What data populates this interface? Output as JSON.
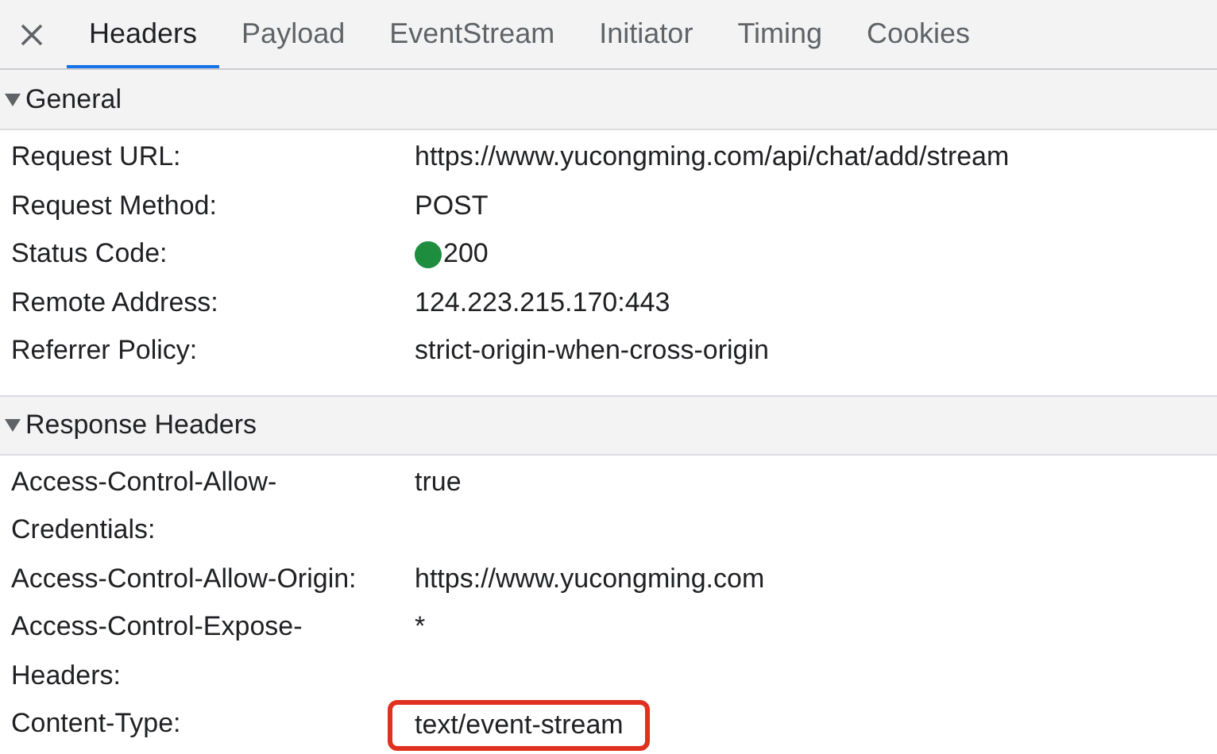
{
  "tabs": [
    {
      "label": "Headers",
      "selected": true
    },
    {
      "label": "Payload",
      "selected": false
    },
    {
      "label": "EventStream",
      "selected": false
    },
    {
      "label": "Initiator",
      "selected": false
    },
    {
      "label": "Timing",
      "selected": false
    },
    {
      "label": "Cookies",
      "selected": false
    }
  ],
  "sections": [
    {
      "title": "General",
      "expanded": true,
      "rows": [
        {
          "name": "Request URL:",
          "value": "https://www.yucongming.com/api/chat/add/stream"
        },
        {
          "name": "Request Method:",
          "value": "POST"
        },
        {
          "name": "Status Code:",
          "value": "200",
          "color": "#1e8e3e"
        },
        {
          "name": "Remote Address:",
          "value": "124.223.215.170:443"
        },
        {
          "name": "Referrer Policy:",
          "value": "strict-origin-when-cross-origin"
        }
      ]
    },
    {
      "title": "Response Headers",
      "expanded": true,
      "rows": [
        {
          "name": "Access-Control-Allow-Credentials:",
          "value": "true"
        },
        {
          "name": "Access-Control-Allow-Origin:",
          "value": "https://www.yucongming.com"
        },
        {
          "name": "Access-Control-Expose-Headers:",
          "value": "*"
        },
        {
          "name": "Content-Type:",
          "value": "text/event-stream",
          "highlighted": true
        }
      ]
    }
  ]
}
